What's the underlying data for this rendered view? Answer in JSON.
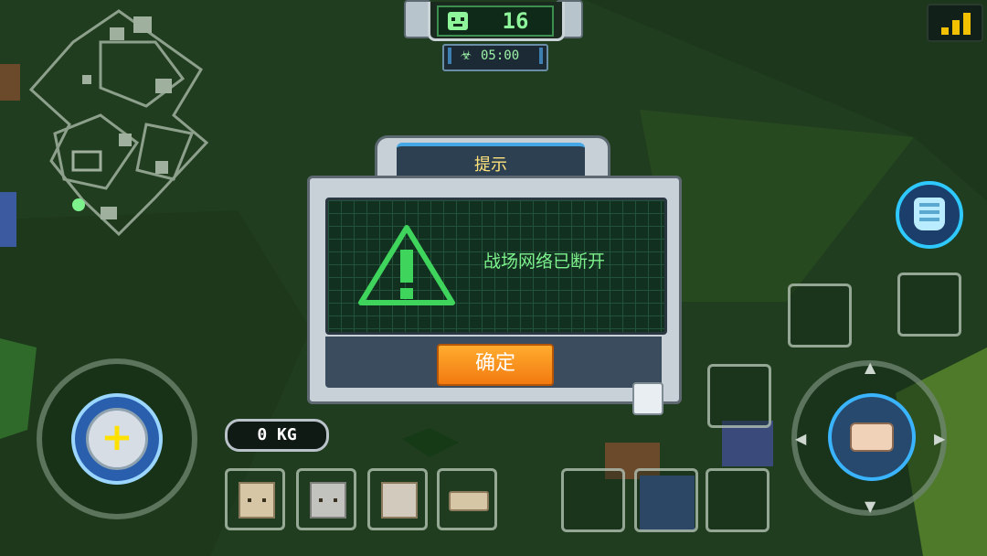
{
  "hud": {
    "player_count": "16",
    "timer": "05:00",
    "icons": {
      "count_icon": "player-face-icon",
      "timer_icon": "biohazard-icon",
      "signal_icon": "signal-bars-icon"
    }
  },
  "dialog": {
    "title": "提示",
    "message": "战场网络已断开",
    "confirm_label": "确定",
    "icon": "warning-triangle-icon"
  },
  "inventory": {
    "weight": "0 KG",
    "slots": [
      {
        "item": "box-face-block"
      },
      {
        "item": "stone-block"
      },
      {
        "item": "armor-block"
      },
      {
        "item": "hand-block"
      }
    ]
  },
  "controls": {
    "move_joystick": "plus-icon",
    "action_joystick": "hand-icon",
    "armor_button": "armor-icon"
  },
  "colors": {
    "accent_green": "#7df28c",
    "title_yellow": "#ffe27a",
    "confirm_orange": "#f27a10",
    "ring_blue": "#3bb4ff",
    "signal_yellow": "#f2c200"
  }
}
